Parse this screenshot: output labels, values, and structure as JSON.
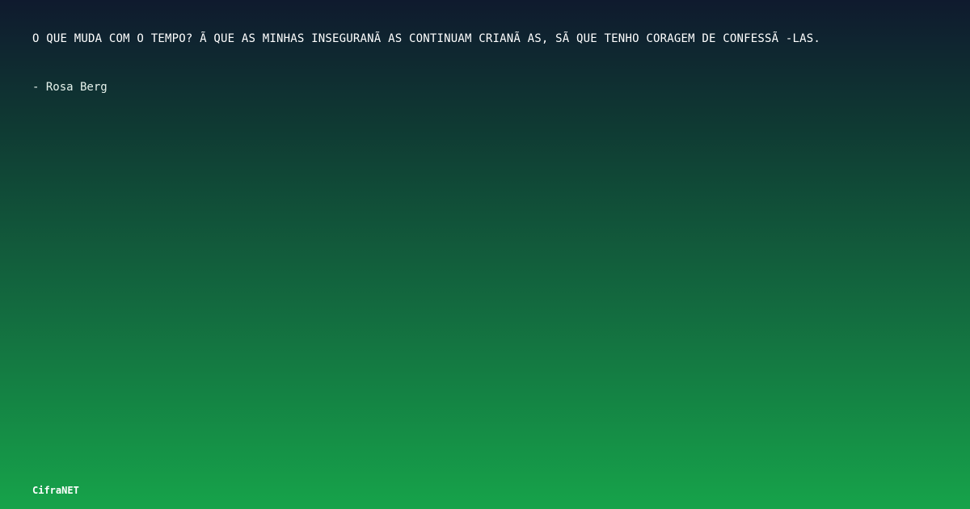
{
  "quote": {
    "text": "O QUE MUDA COM O TEMPO? Ã  QUE AS MINHAS INSEGURANÃ AS CONTINUAM CRIANÃ AS, SÃ  QUE TENHO CORAGEM DE CONFESSÃ -LAS."
  },
  "author": {
    "text": "- Rosa Berg"
  },
  "brand": {
    "label": "CifraNET"
  },
  "colors": {
    "background_top": "#0f1a2e",
    "background_bottom": "#16a34a",
    "text": "#ffffff"
  }
}
